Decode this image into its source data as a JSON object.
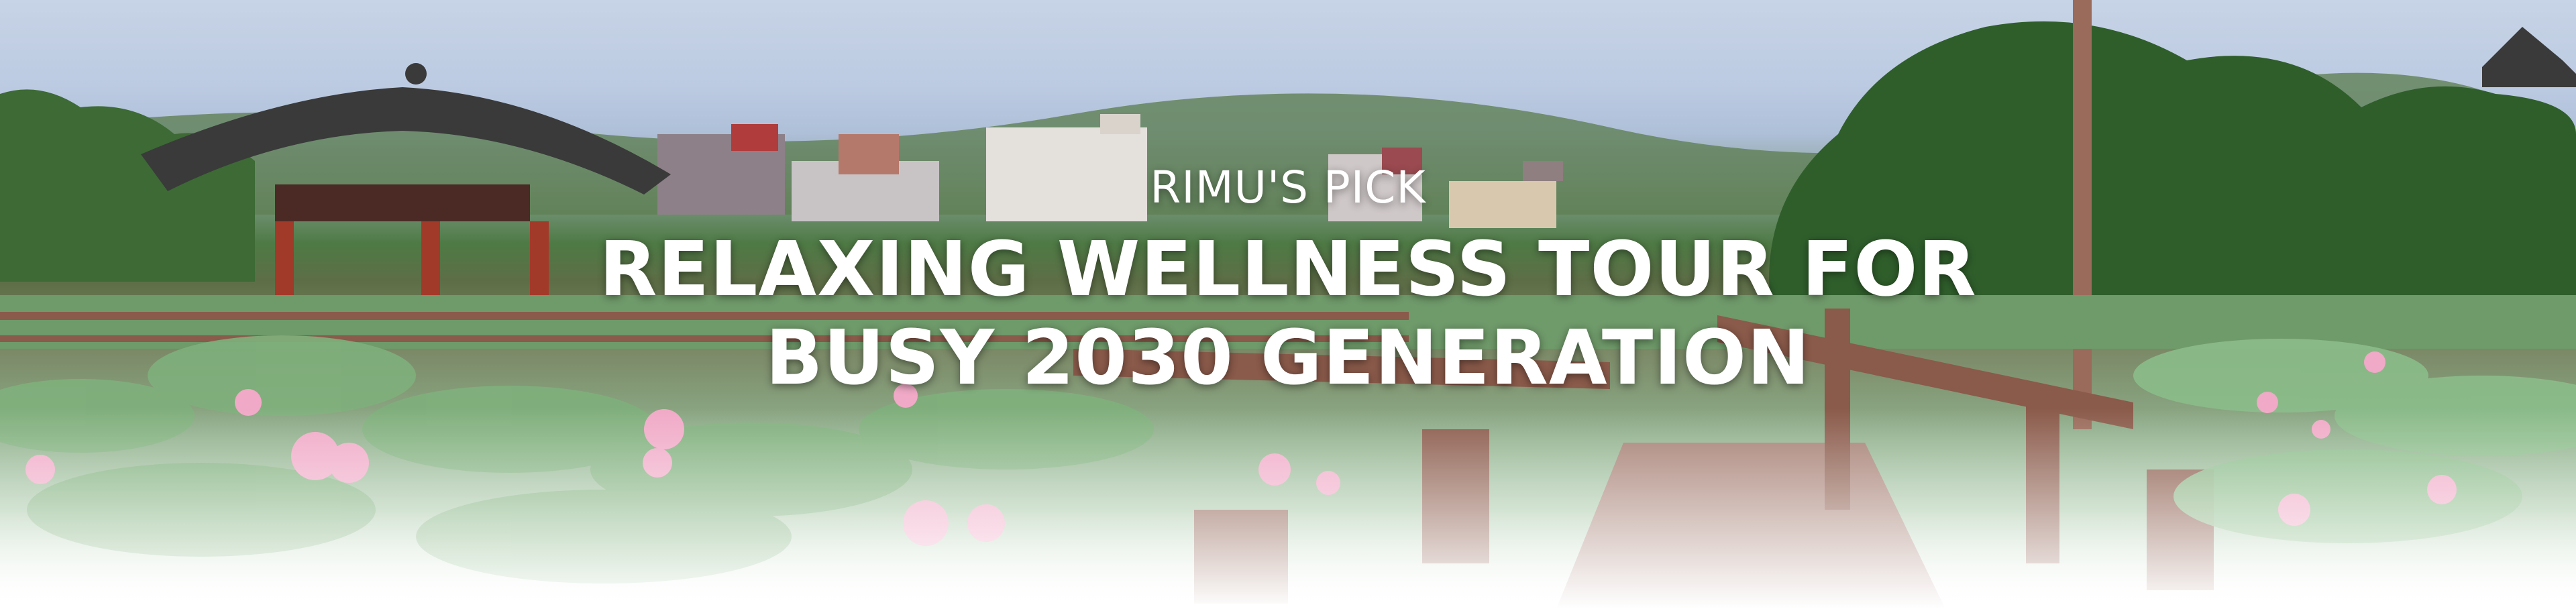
{
  "banner": {
    "kicker": "RIMU'S PICK",
    "headline_line1": "RELAXING WELLNESS TOUR FOR",
    "headline_line2": "BUSY 2030 GENERATION"
  },
  "colors": {
    "text": "#ffffff",
    "sky": "#c7d3e6",
    "foliage": "#3f6e36",
    "lotus_pink": "#f0a9c6",
    "deck_brown": "#8a5a4a",
    "pavilion_roof": "#3a3a3a",
    "pillar_red": "#a23a2a"
  }
}
